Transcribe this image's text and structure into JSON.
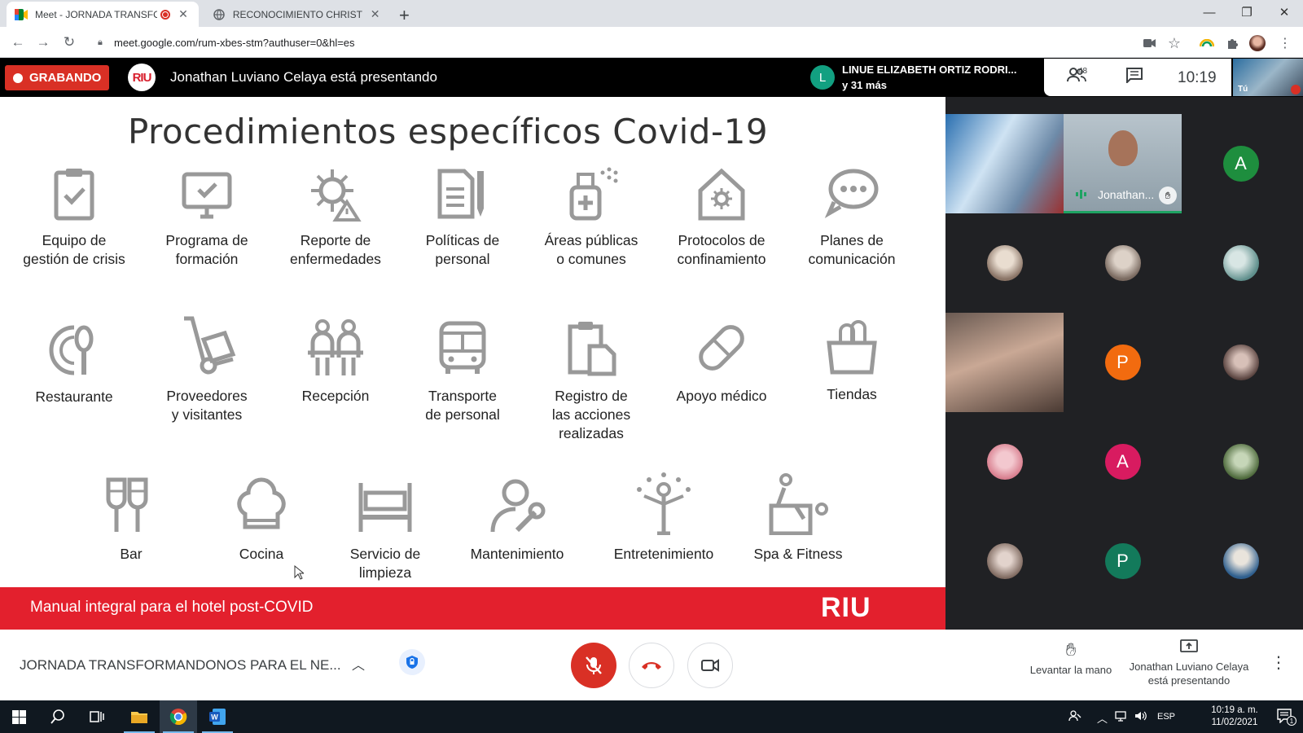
{
  "browser": {
    "tabs": [
      {
        "title": "Meet - JORNADA TRANSFOR",
        "active": true
      },
      {
        "title": "RECONOCIMIENTO CHRISTOPHE",
        "active": false
      }
    ],
    "url": "meet.google.com/rum-xbes-stm?authuser=0&hl=es"
  },
  "meet_bar": {
    "recording_label": "GRABANDO",
    "logo_text": "RIU",
    "presenting_text": "Jonathan Luviano Celaya está presentando",
    "speaker": {
      "initial": "L",
      "name": "LINUE ELIZABETH ORTIZ RODRI...",
      "more": "y 31 más"
    },
    "participant_count": "48",
    "time": "10:19",
    "self_label": "Tú"
  },
  "slide": {
    "title": "Procedimientos específicos Covid-19",
    "row1": [
      {
        "icon": "clipboard-check-icon",
        "label": "Equipo de\ngestión de crisis"
      },
      {
        "icon": "monitor-check-icon",
        "label": "Programa de\nformación"
      },
      {
        "icon": "virus-warning-icon",
        "label": "Reporte de\nenfermedades"
      },
      {
        "icon": "document-pen-icon",
        "label": "Políticas de\npersonal"
      },
      {
        "icon": "spray-bottle-icon",
        "label": "Áreas públicas\no comunes"
      },
      {
        "icon": "house-virus-icon",
        "label": "Protocolos de\nconfinamiento"
      },
      {
        "icon": "chat-bubbles-icon",
        "label": "Planes de\ncomunicación"
      }
    ],
    "row2": [
      {
        "icon": "plate-utensils-icon",
        "label": "Restaurante"
      },
      {
        "icon": "hand-truck-icon",
        "label": "Proveedores\ny visitantes"
      },
      {
        "icon": "reception-people-icon",
        "label": "Recepción"
      },
      {
        "icon": "bus-icon",
        "label": "Transporte\nde personal"
      },
      {
        "icon": "clipboard-docs-icon",
        "label": "Registro de\nlas acciones\nrealizadas"
      },
      {
        "icon": "pill-icon",
        "label": "Apoyo médico"
      },
      {
        "icon": "shopping-bag-icon",
        "label": "Tiendas"
      }
    ],
    "row3": [
      {
        "icon": "wine-glasses-icon",
        "label": "Bar"
      },
      {
        "icon": "chef-hat-icon",
        "label": "Cocina"
      },
      {
        "icon": "bed-icon",
        "label": "Servicio de\nlimpieza"
      },
      {
        "icon": "person-wrench-icon",
        "label": "Mantenimiento"
      },
      {
        "icon": "performer-icon",
        "label": "Entretenimiento"
      },
      {
        "icon": "spa-fitness-icon",
        "label": "Spa & Fitness"
      }
    ],
    "footer_text": "Manual integral para el hotel post-COVID",
    "footer_brand": "RIU"
  },
  "participants": {
    "presenter_name": "Jonathan...",
    "tiles": [
      {
        "type": "video",
        "name": ""
      },
      {
        "type": "video-presenter",
        "name": "Jonathan..."
      },
      {
        "type": "initial",
        "initial": "A",
        "color": "#1e8e3e"
      },
      {
        "type": "photo",
        "color": "#c9b8a8"
      },
      {
        "type": "photo",
        "color": "#bdb3ad"
      },
      {
        "type": "photo",
        "color": "#8fb3b0"
      },
      {
        "type": "video",
        "name": ""
      },
      {
        "type": "initial",
        "initial": "P",
        "color": "#f26b0f"
      },
      {
        "type": "photo",
        "color": "#8b6f6a"
      },
      {
        "type": "photo",
        "color": "#e8a0a8"
      },
      {
        "type": "initial",
        "initial": "A",
        "color": "#d81b60"
      },
      {
        "type": "photo",
        "color": "#6f8a5e"
      },
      {
        "type": "photo",
        "color": "#b49a8f"
      },
      {
        "type": "initial",
        "initial": "P",
        "color": "#137a5b"
      },
      {
        "type": "photo",
        "color": "#3a6e9b"
      }
    ]
  },
  "controls": {
    "meeting_name": "JORNADA TRANSFORMANDONOS PARA EL NE...",
    "raise_hand": "Levantar la mano",
    "presenting_line1": "Jonathan Luviano Celaya",
    "presenting_line2": "está presentando"
  },
  "taskbar": {
    "lang": "ESP",
    "time": "10:19 a. m.",
    "date": "11/02/2021",
    "notif_count": "1"
  }
}
